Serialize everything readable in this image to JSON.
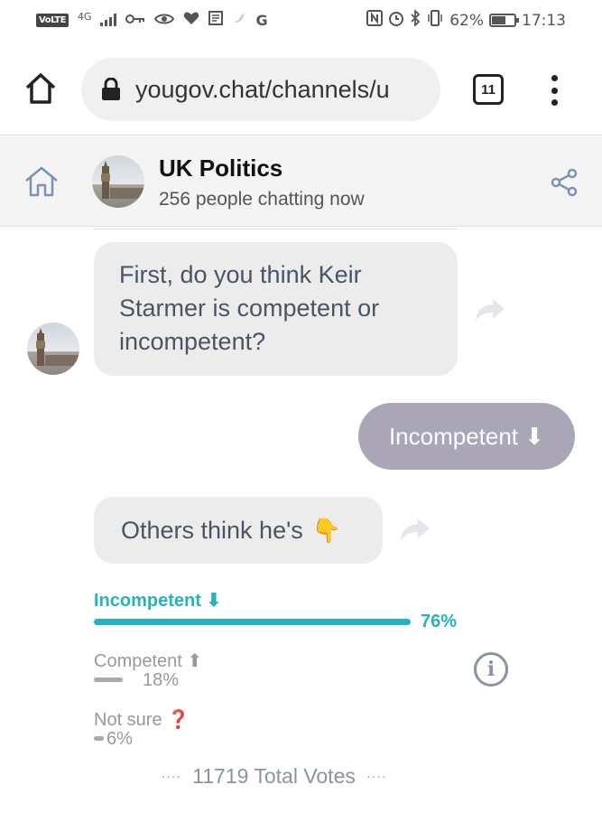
{
  "status_bar": {
    "network": "VoLTE",
    "signal": "4G",
    "battery": "62%",
    "time": "17:13"
  },
  "browser": {
    "url": "yougov.chat/channels/u",
    "tab_count": "11"
  },
  "channel": {
    "title": "UK Politics",
    "subtitle": "256 people chatting now"
  },
  "messages": {
    "question": "First, do you think Keir Starmer is competent or incompetent?",
    "user_answer": "Incompetent ⬇",
    "others_prefix": "Others think he's",
    "others_emoji": "👇"
  },
  "poll": {
    "options": [
      {
        "label": "Incompetent ⬇",
        "percent": "76%",
        "fraction": 0.76
      },
      {
        "label": "Competent ⬆",
        "percent": "18%",
        "fraction": 0.18
      },
      {
        "label": "Not sure ❓",
        "percent": "6%",
        "fraction": 0.06
      }
    ],
    "total": "11719 Total Votes",
    "total_dots": "····"
  },
  "colors": {
    "accent": "#26b3bf",
    "user_bubble": "#aaa6b8",
    "bubble": "#ececec"
  }
}
